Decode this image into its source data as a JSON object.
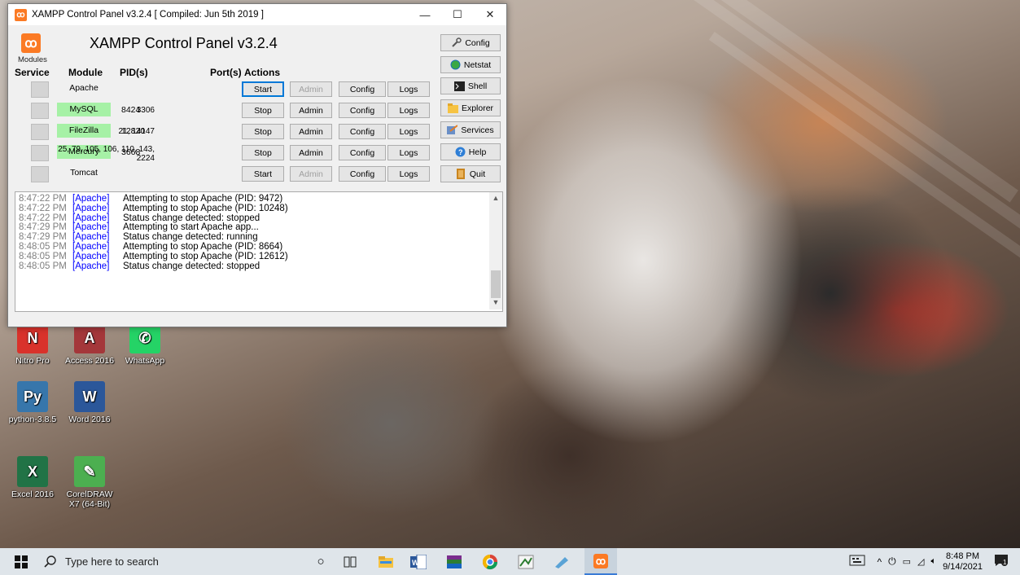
{
  "window": {
    "title": "XAMPP Control Panel v3.2.4   [ Compiled: Jun 5th 2019 ]",
    "controls": {
      "minimize": "—",
      "maximize": "☐",
      "close": "✕"
    }
  },
  "header": {
    "logo_glyph": "ꝏ",
    "title": "XAMPP Control Panel v3.2.4",
    "modules_label": "Modules"
  },
  "columns": {
    "service": "Service",
    "module": "Module",
    "pid": "PID(s)",
    "port": "Port(s)",
    "actions": "Actions"
  },
  "modules": [
    {
      "name": "Apache",
      "pid": "",
      "port": "",
      "running": false,
      "start_label": "Start",
      "admin_label": "Admin",
      "admin_enabled": false,
      "config_label": "Config",
      "logs_label": "Logs"
    },
    {
      "name": "MySQL",
      "pid": "8424",
      "port": "3306",
      "running": true,
      "start_label": "Stop",
      "admin_label": "Admin",
      "admin_enabled": true,
      "config_label": "Config",
      "logs_label": "Logs"
    },
    {
      "name": "FileZilla",
      "pid": "12820",
      "port": "21, 14147",
      "running": true,
      "start_label": "Stop",
      "admin_label": "Admin",
      "admin_enabled": true,
      "config_label": "Config",
      "logs_label": "Logs"
    },
    {
      "name": "Mercury",
      "pid": "3668",
      "port": "25, 79, 105, 106, 110, 143, 2224",
      "running": true,
      "start_label": "Stop",
      "admin_label": "Admin",
      "admin_enabled": true,
      "config_label": "Config",
      "logs_label": "Logs"
    },
    {
      "name": "Tomcat",
      "pid": "",
      "port": "",
      "running": false,
      "start_label": "Start",
      "admin_label": "Admin",
      "admin_enabled": false,
      "config_label": "Config",
      "logs_label": "Logs"
    }
  ],
  "side_buttons": [
    {
      "label": "Config",
      "icon": "wrench-icon"
    },
    {
      "label": "Netstat",
      "icon": "globe-icon"
    },
    {
      "label": "Shell",
      "icon": "terminal-icon"
    },
    {
      "label": "Explorer",
      "icon": "folder-icon"
    },
    {
      "label": "Services",
      "icon": "services-icon"
    },
    {
      "label": "Help",
      "icon": "help-icon"
    },
    {
      "label": "Quit",
      "icon": "quit-icon"
    }
  ],
  "log": [
    {
      "time": "8:47:22 PM",
      "module": "[Apache]",
      "message": "Attempting to stop Apache (PID: 9472)"
    },
    {
      "time": "8:47:22 PM",
      "module": "[Apache]",
      "message": "Attempting to stop Apache (PID: 10248)"
    },
    {
      "time": "8:47:22 PM",
      "module": "[Apache]",
      "message": "Status change detected: stopped"
    },
    {
      "time": "8:47:29 PM",
      "module": "[Apache]",
      "message": "Attempting to start Apache app..."
    },
    {
      "time": "8:47:29 PM",
      "module": "[Apache]",
      "message": "Status change detected: running"
    },
    {
      "time": "8:48:05 PM",
      "module": "[Apache]",
      "message": "Attempting to stop Apache (PID: 8664)"
    },
    {
      "time": "8:48:05 PM",
      "module": "[Apache]",
      "message": "Attempting to stop Apache (PID: 12612)"
    },
    {
      "time": "8:48:05 PM",
      "module": "[Apache]",
      "message": "Status change detected: stopped"
    }
  ],
  "desktop_icons": [
    {
      "label": "Nitro Pro",
      "icon": "nitro-pro-icon",
      "color": "#d9322b",
      "glyph": "N"
    },
    {
      "label": "Access 2016",
      "icon": "access-icon",
      "color": "#a4373a",
      "glyph": "A"
    },
    {
      "label": "WhatsApp",
      "icon": "whatsapp-icon",
      "color": "#25d366",
      "glyph": "✆"
    },
    {
      "label": "python-3.8.5",
      "icon": "python-icon",
      "color": "#3776ab",
      "glyph": "Py"
    },
    {
      "label": "Word 2016",
      "icon": "word-icon",
      "color": "#2b579a",
      "glyph": "W"
    },
    {
      "label": "Excel 2016",
      "icon": "excel-icon",
      "color": "#217346",
      "glyph": "X"
    },
    {
      "label": "CorelDRAW X7 (64-Bit)",
      "icon": "coreldraw-icon",
      "color": "#4caf50",
      "glyph": "✎"
    }
  ],
  "taskbar": {
    "search_placeholder": "Type here to search",
    "time": "8:48 PM",
    "date": "9/14/2021",
    "notification_count": "1"
  }
}
